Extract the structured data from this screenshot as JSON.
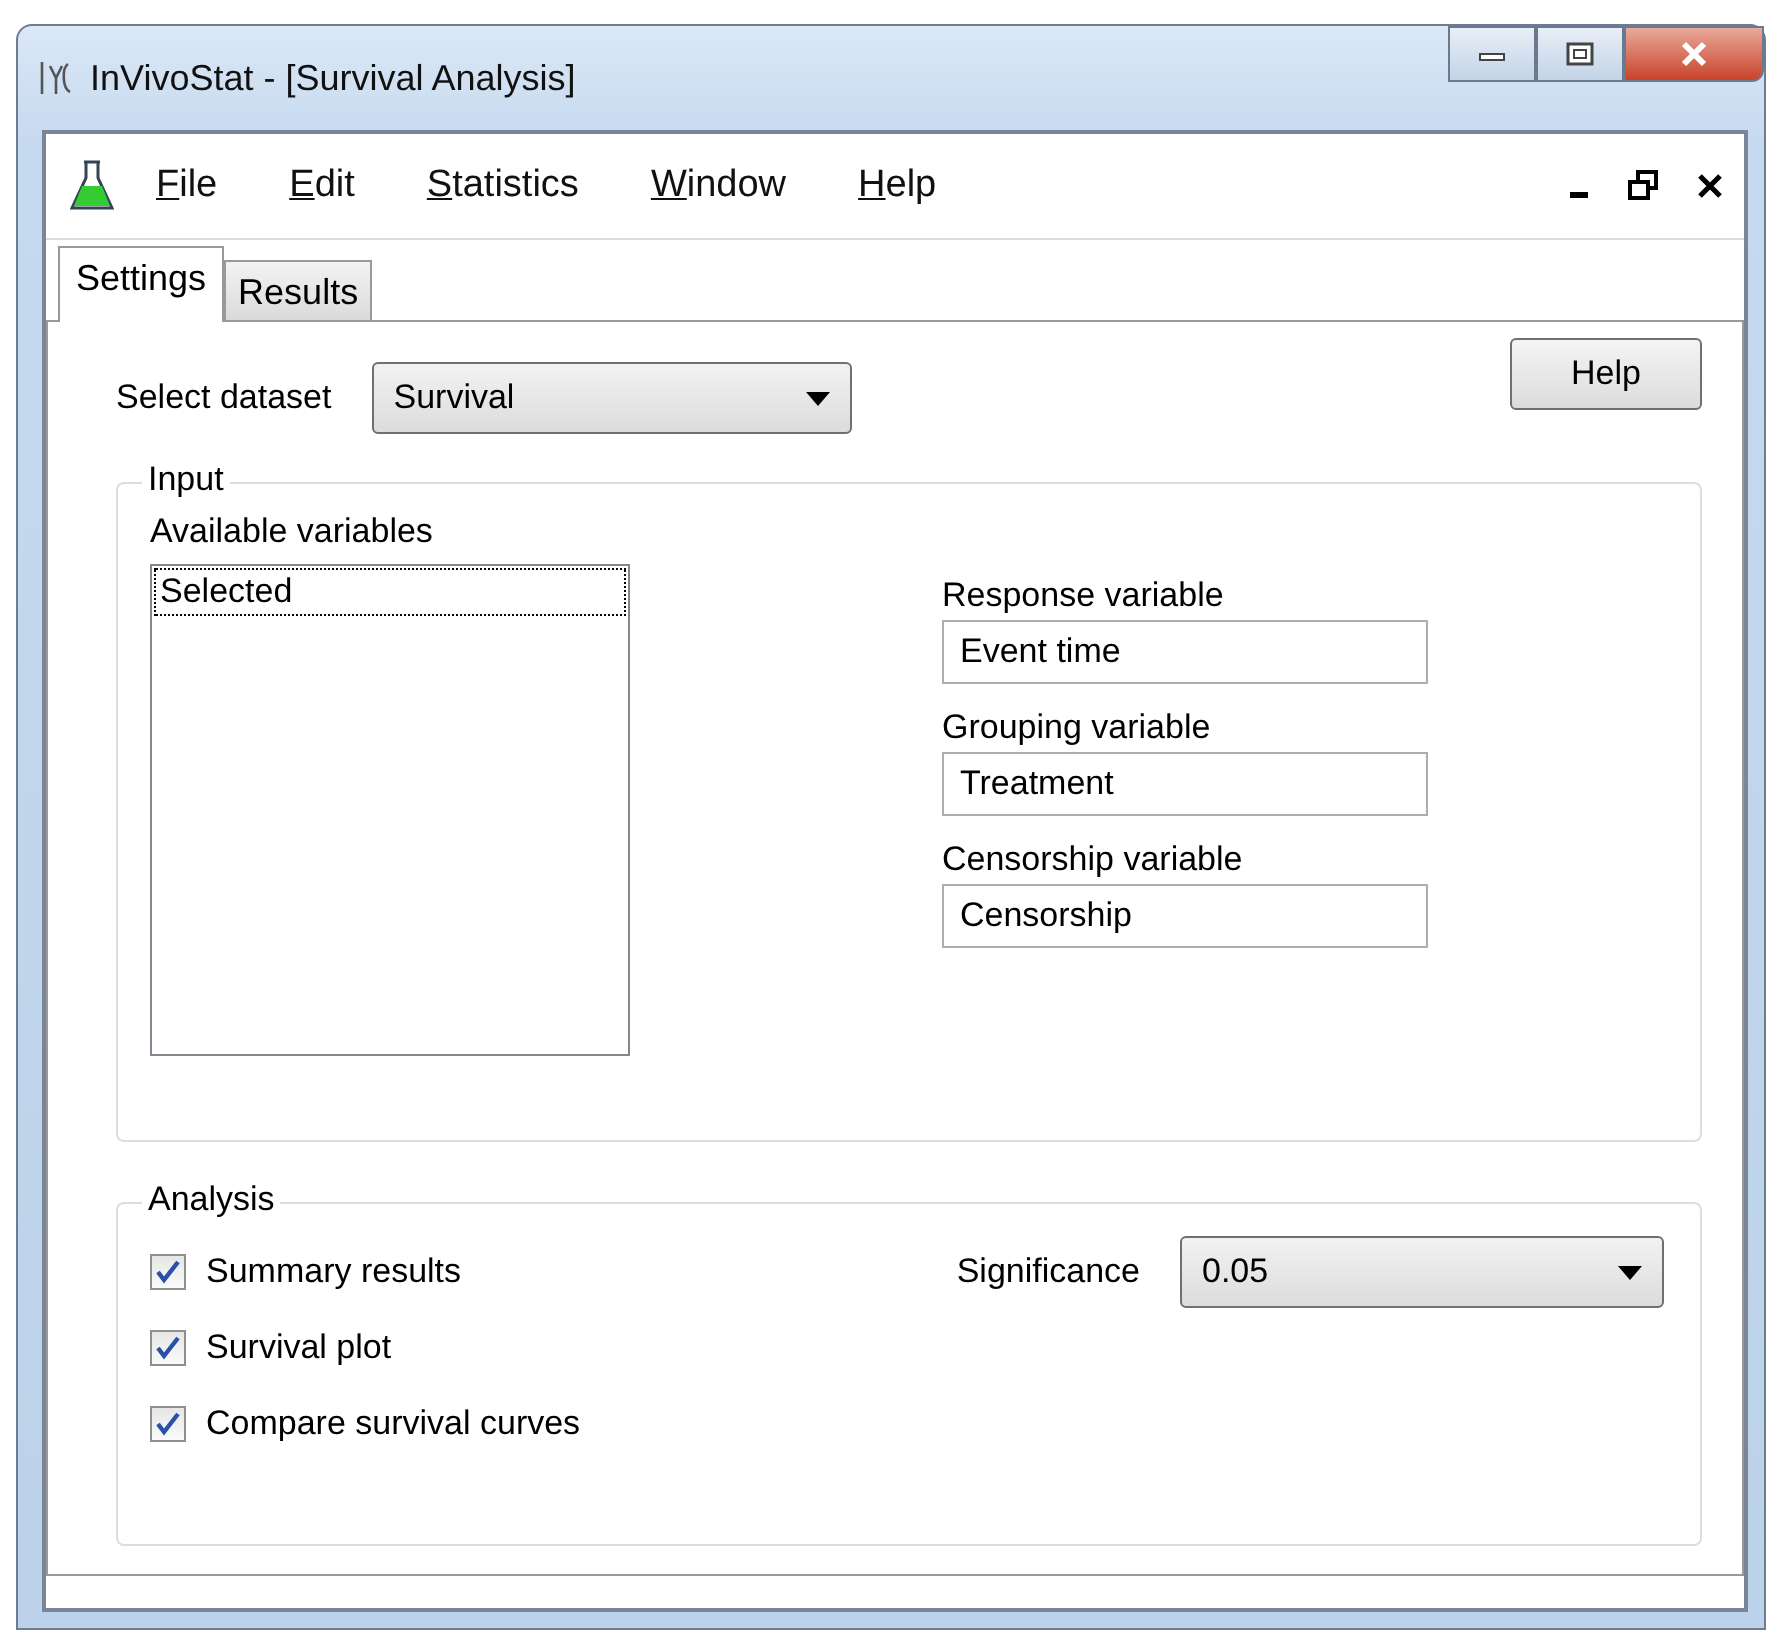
{
  "window": {
    "title": "InVivoStat - [Survival Analysis]"
  },
  "menu": [
    {
      "label": "File"
    },
    {
      "label": "Edit"
    },
    {
      "label": "Statistics"
    },
    {
      "label": "Window"
    },
    {
      "label": "Help"
    }
  ],
  "tabs": [
    {
      "label": "Settings",
      "selected": true
    },
    {
      "label": "Results",
      "selected": false
    }
  ],
  "dataset": {
    "label": "Select dataset",
    "value": "Survival"
  },
  "help_button": "Help",
  "input": {
    "title": "Input",
    "available_label": "Available variables",
    "available_items": [
      {
        "label": "Selected",
        "selected": true
      }
    ],
    "fields": [
      {
        "label": "Response variable",
        "value": "Event time"
      },
      {
        "label": "Grouping variable",
        "value": "Treatment"
      },
      {
        "label": "Censorship variable",
        "value": "Censorship"
      }
    ]
  },
  "analysis": {
    "title": "Analysis",
    "options": [
      {
        "label": "Summary results",
        "checked": true
      },
      {
        "label": "Survival plot",
        "checked": true
      },
      {
        "label": "Compare survival curves",
        "checked": true
      }
    ],
    "significance": {
      "label": "Significance",
      "value": "0.05"
    }
  }
}
